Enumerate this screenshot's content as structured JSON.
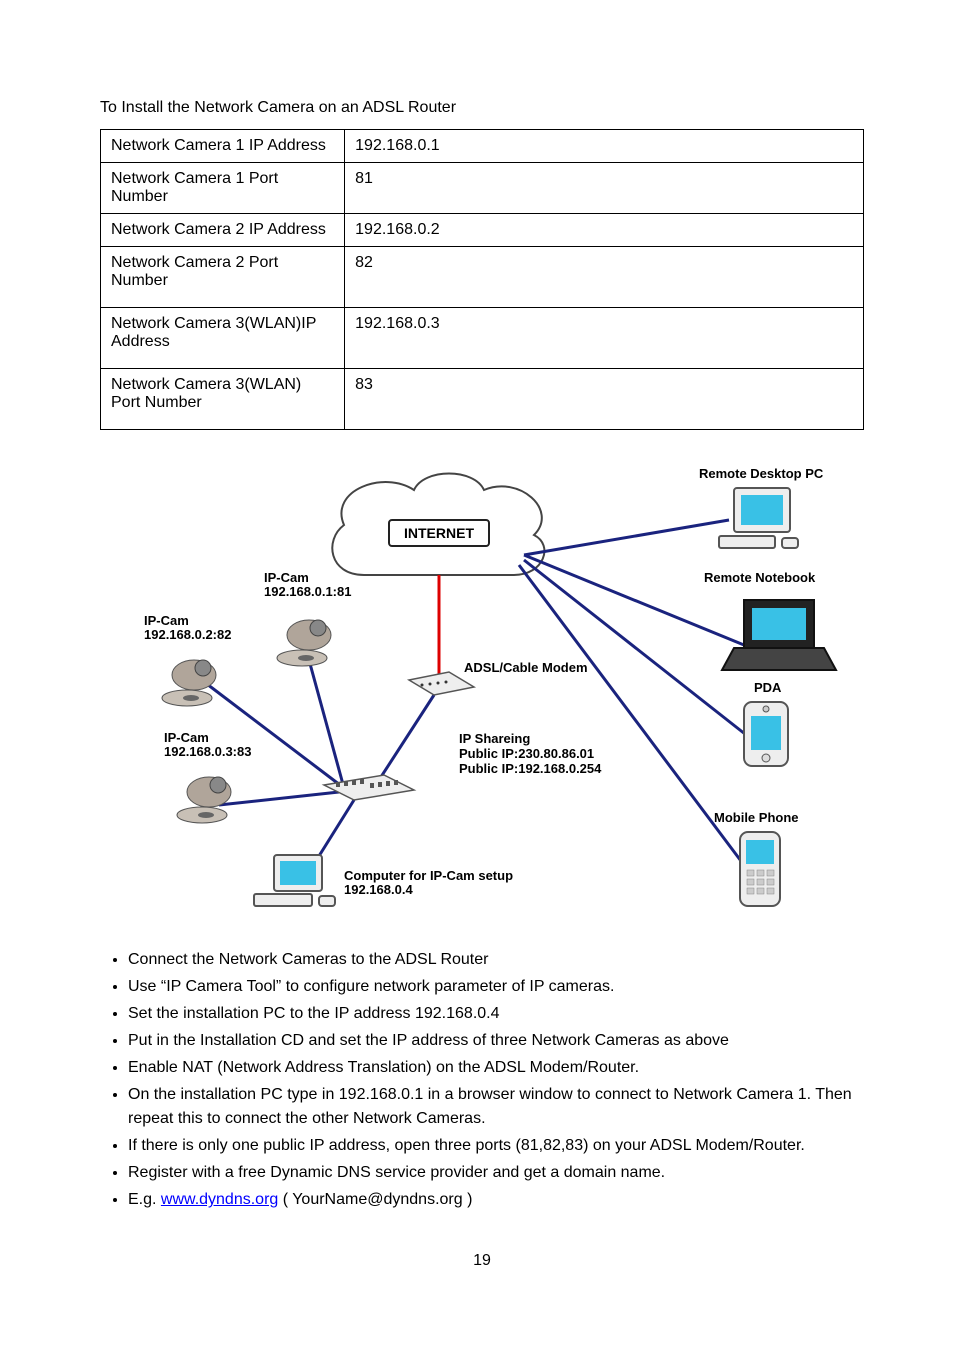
{
  "intro": "To Install the Network Camera on an ADSL Router",
  "table_rows": [
    {
      "name": "Network Camera 1 IP Address",
      "value": "192.168.0.1"
    },
    {
      "name": "Network Camera 1 Port Number",
      "value": "81"
    },
    {
      "name": "Network Camera 2 IP Address",
      "value": "192.168.0.2"
    },
    {
      "name": "Network Camera 2 Port Number",
      "value": "82"
    },
    {
      "name": "Network Camera 3(WLAN)IP Address",
      "value": "192.168.0.3"
    },
    {
      "name": "Network Camera 3(WLAN) Port Number",
      "value": "83"
    }
  ],
  "diagram": {
    "title_internet": "INTERNET",
    "ipcam1_label1": "IP-Cam",
    "ipcam1_label2": "192.168.0.1:81",
    "ipcam2_label1": "IP-Cam",
    "ipcam2_label2": "192.168.0.2:82",
    "ipcam3_label1": "IP-Cam",
    "ipcam3_label2": "192.168.0.3:83",
    "modem_label": "ADSL/Cable Modem",
    "sharing_label1": "IP Shareing",
    "sharing_label2": "Public IP:230.80.86.01",
    "sharing_label3": "Public IP:192.168.0.254",
    "pc_setup_label1": "Computer for IP-Cam setup",
    "pc_setup_label2": "192.168.0.4",
    "remote_desktop": "Remote Desktop PC",
    "remote_notebook": "Remote Notebook",
    "pda": "PDA",
    "mobile": "Mobile Phone"
  },
  "bullets": [
    {
      "text": "Connect the Network Cameras to the ADSL Router"
    },
    {
      "text": "Use “IP Camera Tool” to configure network parameter of IP cameras."
    },
    {
      "text": "Set the installation PC to the IP address 192.168.0.4"
    },
    {
      "text": "Put in the Installation CD and set the IP address of three Network Cameras as above"
    },
    {
      "text": "Enable NAT (Network Address Translation) on the ADSL Modem/Router."
    },
    {
      "text": "On the installation PC type in 192.168.0.1 in a browser window to connect to Network Camera 1. Then repeat this to connect the other Network Cameras."
    },
    {
      "text": "If there is only one public IP address, open three ports (81,82,83) on your ADSL Modem/Router."
    },
    {
      "text": "Register with a free Dynamic DNS service provider and get a domain name."
    },
    {
      "text": "E.g. ",
      "link_text": "www.dyndns.org",
      "link_href": "http://www.dyndns.org",
      "after": "    ( YourName@dyndns.org )"
    }
  ],
  "page_number": "19"
}
